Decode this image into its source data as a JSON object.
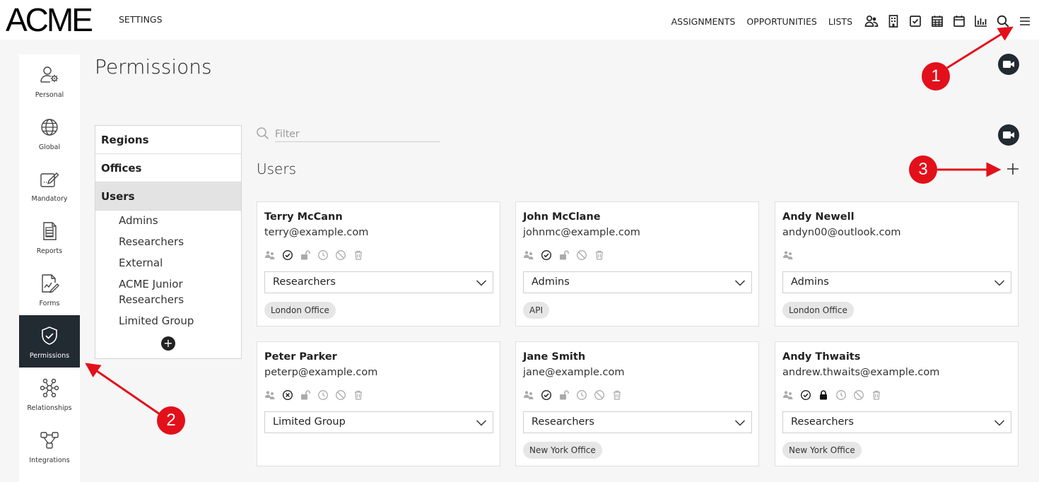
{
  "header": {
    "logo": "ACME",
    "settings_label": "SETTINGS",
    "nav": [
      "ASSIGNMENTS",
      "OPPORTUNITIES",
      "LISTS"
    ],
    "icons": [
      "people-icon",
      "building-icon",
      "checkbox-icon",
      "grid-calendar-icon",
      "calendar-icon",
      "bar-chart-icon",
      "search-icon",
      "menu-icon"
    ]
  },
  "sidebar": {
    "items": [
      {
        "label": "Personal",
        "icon": "user-gear-icon"
      },
      {
        "label": "Global",
        "icon": "globe-icon"
      },
      {
        "label": "Mandatory",
        "icon": "edit-box-icon"
      },
      {
        "label": "Reports",
        "icon": "report-icon"
      },
      {
        "label": "Forms",
        "icon": "form-icon"
      },
      {
        "label": "Permissions",
        "icon": "shield-check-icon",
        "active": true
      },
      {
        "label": "Relationships",
        "icon": "network-icon"
      },
      {
        "label": "Integrations",
        "icon": "integration-icon"
      }
    ]
  },
  "page": {
    "title": "Permissions"
  },
  "subnav": {
    "items": [
      "Regions",
      "Offices",
      "Users"
    ],
    "active": "Users",
    "groups": [
      "Admins",
      "Researchers",
      "External",
      "ACME Junior Researchers",
      "Limited Group"
    ]
  },
  "filter": {
    "placeholder": "Filter"
  },
  "users": {
    "heading": "Users",
    "cards": [
      {
        "name": "Terry McCann",
        "email": "terry@example.com",
        "role": "Researchers",
        "office": "London Office",
        "status": "active"
      },
      {
        "name": "John McClane",
        "email": "johnmc@example.com",
        "role": "Admins",
        "office": "API",
        "status": "active"
      },
      {
        "name": "Andy Newell",
        "email": "andyn00@outlook.com",
        "role": "Admins",
        "office": "London Office",
        "status": "pending"
      },
      {
        "name": "Peter Parker",
        "email": "peterp@example.com",
        "role": "Limited Group",
        "office": "",
        "status": "inactive"
      },
      {
        "name": "Jane Smith",
        "email": "jane@example.com",
        "role": "Researchers",
        "office": "New York Office",
        "status": "active"
      },
      {
        "name": "Andy Thwaits",
        "email": "andrew.thwaits@example.com",
        "role": "Researchers",
        "office": "New York Office",
        "status": "locked"
      }
    ]
  },
  "annotations": [
    "1",
    "2",
    "3"
  ],
  "colors": {
    "accent": "#222a32",
    "marker": "#e2101a"
  }
}
